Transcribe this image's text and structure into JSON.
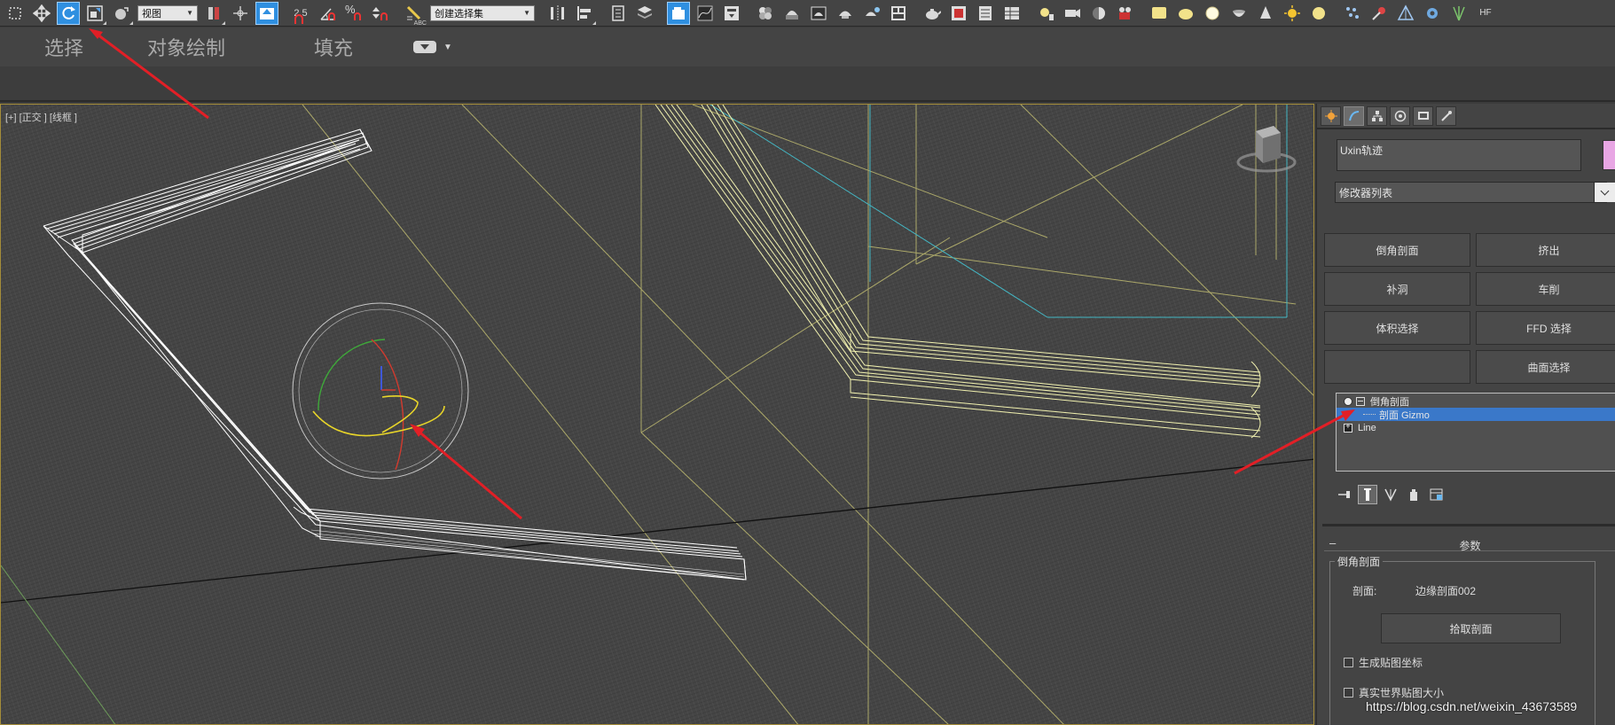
{
  "toolbar": {
    "view_dropdown": "视图",
    "selection_set_dropdown": "创建选择集",
    "snap_25_label": "2.5",
    "percent_snap_label": "%",
    "abc_label": "ABC",
    "colors": {
      "active_blue": "#2f8fe0",
      "teapot": "#d9d9d9",
      "light_yellow": "#f2e28a",
      "sun": "#f4c430"
    }
  },
  "ribbon": {
    "tabs": [
      "选择",
      "对象绘制",
      "填充"
    ]
  },
  "viewport": {
    "label": "[+] [正交 ] [线框 ]"
  },
  "command_panel": {
    "object_name": "Uxin轨迹",
    "object_color": "#e8a6e4",
    "modifier_list": "修改器列表",
    "modifier_buttons": [
      {
        "label": "倒角剖面"
      },
      {
        "label": "挤出"
      },
      {
        "label": "补洞"
      },
      {
        "label": "车削"
      },
      {
        "label": "体积选择"
      },
      {
        "label": "FFD 选择"
      },
      {
        "label": ""
      },
      {
        "label": "曲面选择"
      }
    ],
    "stack": [
      {
        "label": "倒角剖面"
      },
      {
        "label": "剖面 Gizmo"
      },
      {
        "label": "Line"
      }
    ],
    "rollout_title": "参数",
    "group_title": "倒角剖面",
    "profile_label": "剖面:",
    "profile_value": "边缘剖面002",
    "pick_button": "拾取剖面",
    "checkbox_1": "生成贴图坐标",
    "checkbox_2": "真实世界贴图大小"
  },
  "watermark": "https://blog.csdn.net/weixin_43673589",
  "annotation_color": "#e21f26"
}
